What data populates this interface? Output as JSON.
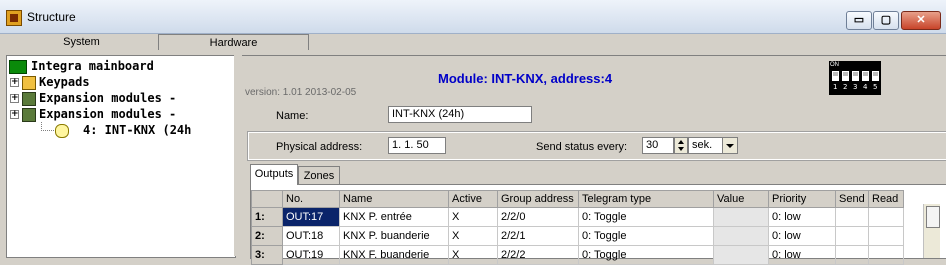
{
  "window": {
    "title": "Structure",
    "minimize": "▭",
    "maximize": "▢",
    "close": "✕"
  },
  "top_tabs": [
    "System",
    "Hardware"
  ],
  "tree": [
    {
      "label": "Integra mainboard",
      "icon": "mainboard-icon"
    },
    {
      "label": "Keypads",
      "icon": "keypad-icon"
    },
    {
      "label": "Expansion modules -",
      "icon": "modules-icon"
    },
    {
      "label": "Expansion modules -",
      "icon": "modules-icon"
    },
    {
      "label": "4: INT-KNX    (24h",
      "icon": "lightbulb-icon"
    }
  ],
  "module": {
    "version": "version: 1.01 2013-02-05",
    "title": "Module: INT-KNX, address:4",
    "dip_labels": [
      "1",
      "2",
      "3",
      "4",
      "5"
    ],
    "dip_on": "ON"
  },
  "form": {
    "name_label": "Name:",
    "name_value": "INT-KNX  (24h)",
    "physical_label": "Physical address:",
    "physical_value": "1. 1. 50",
    "send_status_label": "Send status every:",
    "send_status_value": "30",
    "send_status_unit": "sek."
  },
  "tabs": [
    "Outputs",
    "Zones"
  ],
  "grid": {
    "headers": [
      "No.",
      "Name",
      "Active",
      "Group address",
      "Telegram type",
      "Value",
      "Priority",
      "Send",
      "Read"
    ],
    "rows": [
      {
        "row": "1:",
        "no": "OUT:17",
        "name": "KNX P. entrée",
        "active": "X",
        "group": "2/2/0",
        "telegram": "0: Toggle",
        "value": "",
        "priority": "0: low",
        "send": "",
        "read": ""
      },
      {
        "row": "2:",
        "no": "OUT:18",
        "name": "KNX P. buanderie",
        "active": "X",
        "group": "2/2/1",
        "telegram": "0: Toggle",
        "value": "",
        "priority": "0: low",
        "send": "",
        "read": ""
      },
      {
        "row": "3:",
        "no": "OUT:19",
        "name": "KNX F. buanderie",
        "active": "X",
        "group": "2/2/2",
        "telegram": "0: Toggle",
        "value": "",
        "priority": "0: low",
        "send": "",
        "read": ""
      }
    ]
  }
}
